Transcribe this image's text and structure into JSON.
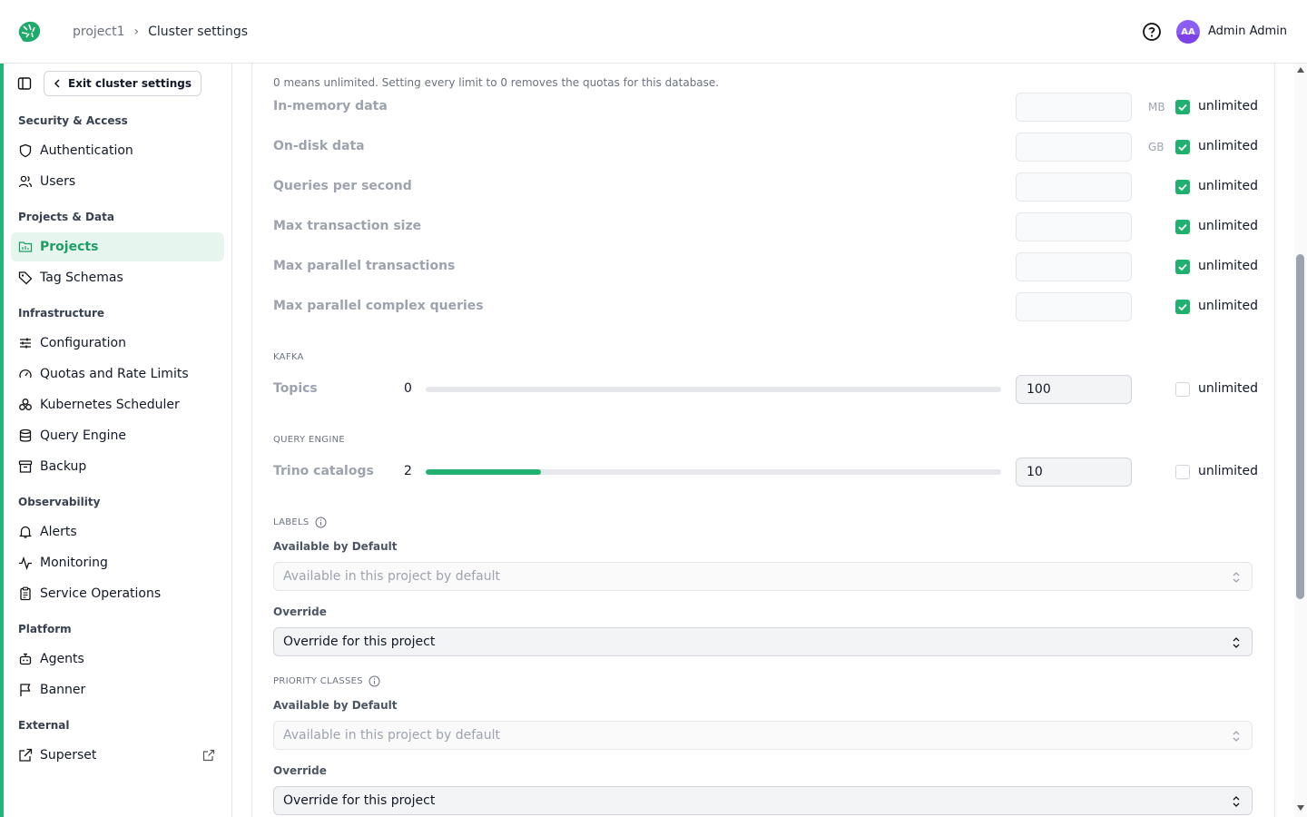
{
  "header": {
    "breadcrumb_project": "project1",
    "breadcrumb_current": "Cluster settings",
    "avatar_initials": "AA",
    "user_name": "Admin Admin"
  },
  "sidebar": {
    "exit_label": "Exit cluster settings",
    "groups": [
      {
        "title": "Security & Access",
        "items": [
          {
            "label": "Authentication",
            "icon": "shield-icon"
          },
          {
            "label": "Users",
            "icon": "users-icon"
          }
        ]
      },
      {
        "title": "Projects & Data",
        "items": [
          {
            "label": "Projects",
            "icon": "folder-icon",
            "active": true
          },
          {
            "label": "Tag Schemas",
            "icon": "tag-icon"
          }
        ]
      },
      {
        "title": "Infrastructure",
        "items": [
          {
            "label": "Configuration",
            "icon": "sliders-icon"
          },
          {
            "label": "Quotas and Rate Limits",
            "icon": "gauge-icon"
          },
          {
            "label": "Kubernetes Scheduler",
            "icon": "cubes-icon"
          },
          {
            "label": "Query Engine",
            "icon": "database-icon"
          },
          {
            "label": "Backup",
            "icon": "archive-icon"
          }
        ]
      },
      {
        "title": "Observability",
        "items": [
          {
            "label": "Alerts",
            "icon": "bell-icon"
          },
          {
            "label": "Monitoring",
            "icon": "activity-icon"
          },
          {
            "label": "Service Operations",
            "icon": "clipboard-icon"
          }
        ]
      },
      {
        "title": "Platform",
        "items": [
          {
            "label": "Agents",
            "icon": "bot-icon"
          },
          {
            "label": "Banner",
            "icon": "flag-icon"
          }
        ]
      },
      {
        "title": "External",
        "items": [
          {
            "label": "Superset",
            "icon": "external-link-icon"
          }
        ]
      }
    ]
  },
  "quotas": {
    "note": "0 means unlimited. Setting every limit to 0 removes the quotas for this database.",
    "rows": [
      {
        "label": "In-memory data",
        "value": "",
        "unit": "MB",
        "unlimited": true
      },
      {
        "label": "On-disk data",
        "value": "",
        "unit": "GB",
        "unlimited": true
      },
      {
        "label": "Queries per second",
        "value": "",
        "unit": "",
        "unlimited": true
      },
      {
        "label": "Max transaction size",
        "value": "",
        "unit": "",
        "unlimited": true
      },
      {
        "label": "Max parallel transactions",
        "value": "",
        "unit": "",
        "unlimited": true
      },
      {
        "label": "Max parallel complex queries",
        "value": "",
        "unit": "",
        "unlimited": true
      }
    ],
    "unlimited_label": "unlimited"
  },
  "kafka": {
    "caption": "KAFKA",
    "label": "Topics",
    "used": "0",
    "limit": "100",
    "usage_fraction": 0.0,
    "unlimited": false
  },
  "query_engine": {
    "caption": "QUERY ENGINE",
    "label": "Trino catalogs",
    "used": "2",
    "limit": "10",
    "usage_fraction": 0.2,
    "unlimited": false
  },
  "labels": {
    "caption": "LABELS",
    "default_label": "Available by Default",
    "default_placeholder": "Available in this project by default",
    "override_label": "Override",
    "override_value": "Override for this project"
  },
  "priority_classes": {
    "caption": "PRIORITY CLASSES",
    "default_label": "Available by Default",
    "default_placeholder": "Available in this project by default",
    "override_label": "Override",
    "override_value": "Override for this project"
  },
  "colors": {
    "accent": "#22b573",
    "active_nav_bg": "#e6f6ee",
    "checkbox_on": "#20b16f"
  }
}
